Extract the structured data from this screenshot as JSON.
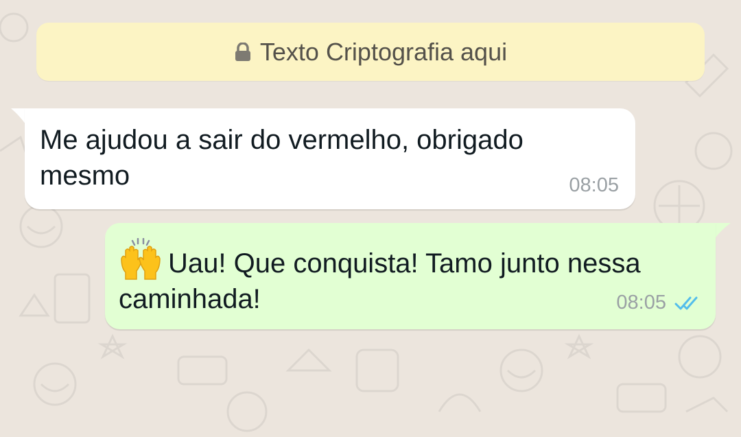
{
  "encryption_notice": {
    "text": "Texto Criptografia aqui",
    "icon": "lock-icon"
  },
  "messages": [
    {
      "direction": "incoming",
      "text": "Me ajudou a sair do vermelho, obrigado mesmo",
      "time": "08:05"
    },
    {
      "direction": "outgoing",
      "emoji": "🙌",
      "text": "Uau! Que conquista! Tamo junto nessa caminhada!",
      "time": "08:05",
      "status": "read",
      "status_icon": "double-check-icon"
    }
  ],
  "colors": {
    "chat_background": "#ece5dd",
    "notice_background": "#fcf4c4",
    "incoming_bubble": "#ffffff",
    "outgoing_bubble": "#e2ffd3",
    "read_ticks": "#53bdeb"
  }
}
